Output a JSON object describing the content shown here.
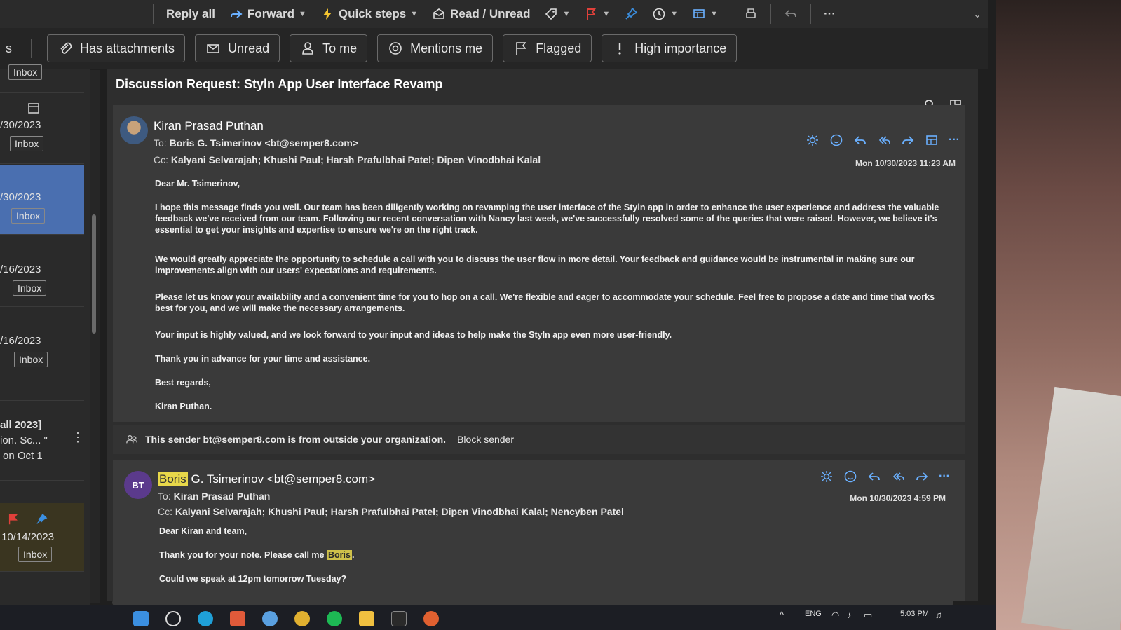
{
  "ribbon": {
    "quick_steps": "Quick steps",
    "read_unread": "Read / Unread",
    "forward": "Forward",
    "reply_all": "Reply all",
    "more": "···"
  },
  "filters": {
    "partial_left": "s",
    "items": [
      "Has attachments",
      "Unread",
      "To me",
      "Mentions me",
      "Flagged",
      "High importance"
    ]
  },
  "message_list": {
    "items": [
      {
        "date": "",
        "folder": "Inbox"
      },
      {
        "date": "/30/2023",
        "folder": "Inbox"
      },
      {
        "date": "/30/2023",
        "folder": "Inbox"
      },
      {
        "date": "/16/2023",
        "folder": "Inbox"
      },
      {
        "date": "/16/2023",
        "folder": "Inbox"
      },
      {
        "preview_1": "all 2023]",
        "preview_2": "ion. Sc... \"",
        "preview_3": "on Oct 1"
      },
      {
        "date": "10/14/2023",
        "folder": "Inbox"
      }
    ]
  },
  "reading_pane": {
    "subject": "Discussion Request: Styln App User Interface Revamp",
    "message1": {
      "sender": "Kiran Prasad Puthan",
      "to_label": "To:",
      "to": "Boris G. Tsimerinov <bt@semper8.com>",
      "cc_label": "Cc:",
      "cc": "Kalyani Selvarajah;  Khushi Paul;  Harsh Prafulbhai Patel;  Dipen Vinodbhai Kalal",
      "timestamp": "Mon 10/30/2023 11:23 AM",
      "greeting": "Dear Mr. Tsimerinov,",
      "p1": "I hope this message finds you well. Our team has been diligently working on revamping the user interface of the Styln app in order to enhance the user experience and address the valuable feedback we've received from our team. Following our recent conversation with Nancy last week, we've successfully resolved some of the queries that were raised. However, we believe it's essential to get your insights and expertise to ensure we're on the right track.",
      "p2": "We would greatly appreciate the opportunity to schedule a call with you to discuss the user flow in more detail. Your feedback and guidance would be instrumental in making sure our improvements align with our users' expectations and requirements.",
      "p3": "Please let us know your availability and a convenient time for you to hop on a call. We're flexible and eager to accommodate your schedule. Feel free to propose a date and time that works best for you, and we will make the necessary arrangements.",
      "p4": "Your input is highly valued, and we look forward to your input and ideas to help make the Styln app even more user-friendly.",
      "p5": "Thank you in advance for your time and assistance.",
      "closing": "Best regards,",
      "signature": "Kiran Puthan."
    },
    "external_notice": "This sender bt@semper8.com is from outside your organization.",
    "block_sender": "Block sender",
    "message2": {
      "initials": "BT",
      "sender_first": "Boris",
      "sender_rest": "G. Tsimerinov <bt@semper8.com>",
      "to_label": "To:",
      "to": "Kiran Prasad Puthan",
      "cc_label": "Cc:",
      "cc": "Kalyani Selvarajah;  Khushi Paul;  Harsh Prafulbhai Patel;  Dipen Vinodbhai Kalal;  Nencyben Patel",
      "timestamp": "Mon 10/30/2023 4:59 PM",
      "greeting": "Dear Kiran and team,",
      "p1_before": "Thank you for your note. Please call me",
      "p1_name": "Boris",
      "p1_after": ".",
      "p2": "Could we speak at 12pm tomorrow Tuesday?"
    }
  },
  "taskbar": {
    "lang": "ENG",
    "time": "5:03 PM"
  },
  "colors": {
    "accent_blue": "#4a6fb0",
    "highlight": "#e8d84a",
    "flag_red": "#e0403a",
    "pin_blue": "#3b8fe0",
    "avatar_purple": "#5b3a8c"
  }
}
